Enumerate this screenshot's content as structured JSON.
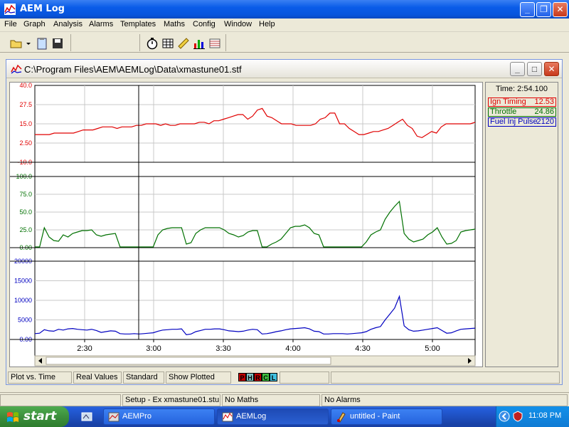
{
  "app": {
    "title": "AEM Log",
    "title_icon": "chart-icon"
  },
  "menu": [
    "File",
    "Graph",
    "Analysis",
    "Alarms",
    "Templates",
    "Maths",
    "Config",
    "Window",
    "Help"
  ],
  "toolbar": {
    "group1": [
      "open-folder-icon",
      "dropdown-arrow-icon",
      "clipboard-icon",
      "save-icon"
    ],
    "group2": [
      "stopwatch-icon",
      "table-icon",
      "ruler-icon",
      "bar-chart-icon",
      "grid-icon"
    ]
  },
  "window": {
    "title": "C:\\Program Files\\AEM\\AEMLog\\Data\\xmastune01.stf"
  },
  "side_panel": {
    "time_label": "Time: 2:54.100",
    "channels": [
      {
        "name": "Ign Timing",
        "value": "12.53",
        "color": "#e00000"
      },
      {
        "name": "Throttle",
        "value": "24.86",
        "color": "#007000"
      },
      {
        "name": "Fuel Inj Pulse",
        "value": "2120",
        "color": "#0000c0"
      }
    ]
  },
  "chart_data": {
    "type": "line",
    "x_axis": {
      "ticks": [
        "2:30",
        "3:00",
        "3:30",
        "4:00",
        "4:30",
        "5:00"
      ]
    },
    "cursor": "2:54.100",
    "panels": [
      {
        "name": "Ign Timing",
        "color": "#e00000",
        "y_ticks": [
          "40.0",
          "27.5",
          "15.0",
          "2.50",
          "-10.0"
        ],
        "ylim": [
          -10,
          40
        ],
        "values": [
          8,
          8,
          8,
          8,
          9,
          9,
          9,
          9,
          9,
          10,
          11,
          11,
          11,
          12,
          13,
          13,
          13,
          12,
          13,
          13,
          13,
          14,
          14,
          15,
          15,
          15,
          14,
          15,
          14,
          14,
          15,
          15,
          15,
          15,
          16,
          16,
          15,
          17,
          17,
          18,
          19,
          20,
          21,
          21,
          18,
          20,
          24,
          25,
          20,
          19,
          17,
          15,
          15,
          15,
          14,
          14,
          14,
          14,
          15,
          18,
          19,
          22,
          22,
          15,
          15,
          12,
          10,
          8,
          8,
          9,
          10,
          10,
          11,
          12,
          14,
          16,
          18,
          14,
          12,
          7,
          6,
          8,
          10,
          9,
          13,
          15,
          15,
          15,
          15,
          15,
          15,
          16
        ]
      },
      {
        "name": "Throttle",
        "color": "#007000",
        "y_ticks": [
          "100.0",
          "75.0",
          "50.0",
          "25.0",
          "0.00"
        ],
        "ylim": [
          0,
          100
        ],
        "values": [
          1,
          1,
          28,
          15,
          10,
          9,
          18,
          15,
          20,
          22,
          24,
          24,
          25,
          18,
          16,
          18,
          19,
          20,
          1,
          1,
          1,
          1,
          1,
          1,
          1,
          1,
          18,
          25,
          27,
          28,
          28,
          28,
          5,
          7,
          20,
          25,
          28,
          28,
          28,
          28,
          25,
          20,
          18,
          15,
          17,
          22,
          24,
          24,
          1,
          1,
          5,
          8,
          12,
          20,
          28,
          30,
          30,
          32,
          28,
          20,
          18,
          1,
          1,
          1,
          1,
          1,
          1,
          1,
          1,
          1,
          8,
          18,
          22,
          25,
          40,
          50,
          58,
          65,
          20,
          12,
          8,
          10,
          12,
          18,
          22,
          28,
          15,
          5,
          6,
          10,
          22,
          24,
          25,
          26
        ]
      },
      {
        "name": "Fuel Inj Pulse",
        "color": "#0000c0",
        "y_ticks": [
          "20000",
          "15000",
          "10000",
          "5000",
          "0.00"
        ],
        "ylim": [
          0,
          20000
        ],
        "values": [
          1500,
          1600,
          2500,
          2200,
          2100,
          2600,
          2400,
          2700,
          2800,
          2600,
          2500,
          2400,
          2600,
          2300,
          1800,
          2000,
          2200,
          2100,
          1500,
          1400,
          1400,
          1500,
          1400,
          1500,
          1600,
          1700,
          2100,
          2400,
          2500,
          2600,
          2600,
          2700,
          1200,
          1400,
          2000,
          2300,
          2600,
          2600,
          2700,
          2700,
          2500,
          2200,
          2100,
          2000,
          2100,
          2400,
          2600,
          2500,
          1400,
          1500,
          1700,
          2000,
          2200,
          2500,
          2700,
          2800,
          2900,
          3000,
          2700,
          2100,
          2000,
          1400,
          1400,
          1500,
          1500,
          1500,
          1400,
          1500,
          1600,
          1700,
          2000,
          2600,
          3000,
          3300,
          5000,
          6500,
          8000,
          11000,
          3500,
          2500,
          2100,
          2200,
          2400,
          2600,
          2800,
          3000,
          2300,
          1600,
          1700,
          2200,
          2600,
          2700,
          2800,
          2900
        ]
      }
    ]
  },
  "plot_status": {
    "mode": "Plot vs. Time",
    "values": "Real Values",
    "style": "Standard",
    "show": "Show Plotted",
    "letters": [
      {
        "letter": "P",
        "bg": "#c00000"
      },
      {
        "letter": "H",
        "bg": "#80c0c0"
      },
      {
        "letter": "R",
        "bg": "#c00000"
      },
      {
        "letter": "C",
        "bg": "#40c040"
      },
      {
        "letter": "L",
        "bg": "#40c0e0"
      }
    ]
  },
  "app_status": {
    "setup": "Setup - Ex xmastune01.stu",
    "maths": "No Maths",
    "alarms": "No Alarms"
  },
  "taskbar": {
    "start": "start",
    "tasks": [
      {
        "label": "AEMPro",
        "icon": "aempro-icon",
        "active": false
      },
      {
        "label": "AEMLog",
        "icon": "aemlog-icon",
        "active": true
      },
      {
        "label": "untitled - Paint",
        "icon": "paint-icon",
        "active": false
      }
    ],
    "clock": "11:08 PM"
  }
}
